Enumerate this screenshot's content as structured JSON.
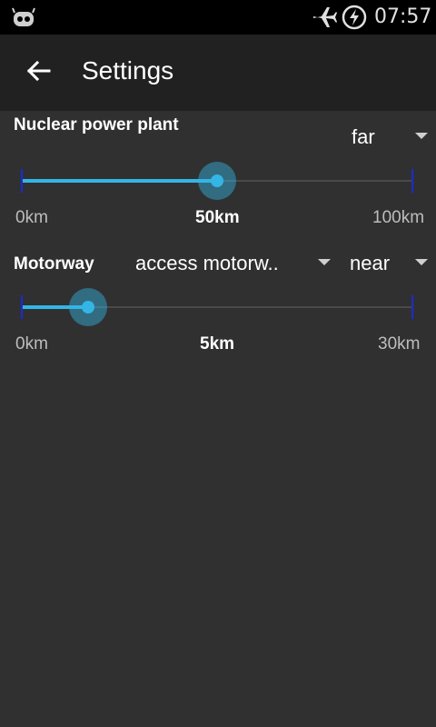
{
  "status_bar": {
    "time": "07:57",
    "icons": [
      "cyanogen-robot-icon",
      "airplane-mode-icon",
      "battery-charging-icon"
    ]
  },
  "app_bar": {
    "title": "Settings",
    "back_icon": "arrow-back-icon"
  },
  "rows": [
    {
      "label": "Nuclear power plant",
      "proximity": "far",
      "slider": {
        "min_label": "0km",
        "value_label": "50km",
        "max_label": "100km",
        "value_fraction": 0.5
      }
    },
    {
      "label": "Motorway",
      "type": "access motorw..",
      "proximity": "near",
      "slider": {
        "min_label": "0km",
        "value_label": "5km",
        "max_label": "30km",
        "value_fraction": 0.17
      }
    }
  ],
  "colors": {
    "accent": "#33b5e5",
    "tick": "#1a2bd6",
    "background": "#303030",
    "appbar": "#212121"
  }
}
